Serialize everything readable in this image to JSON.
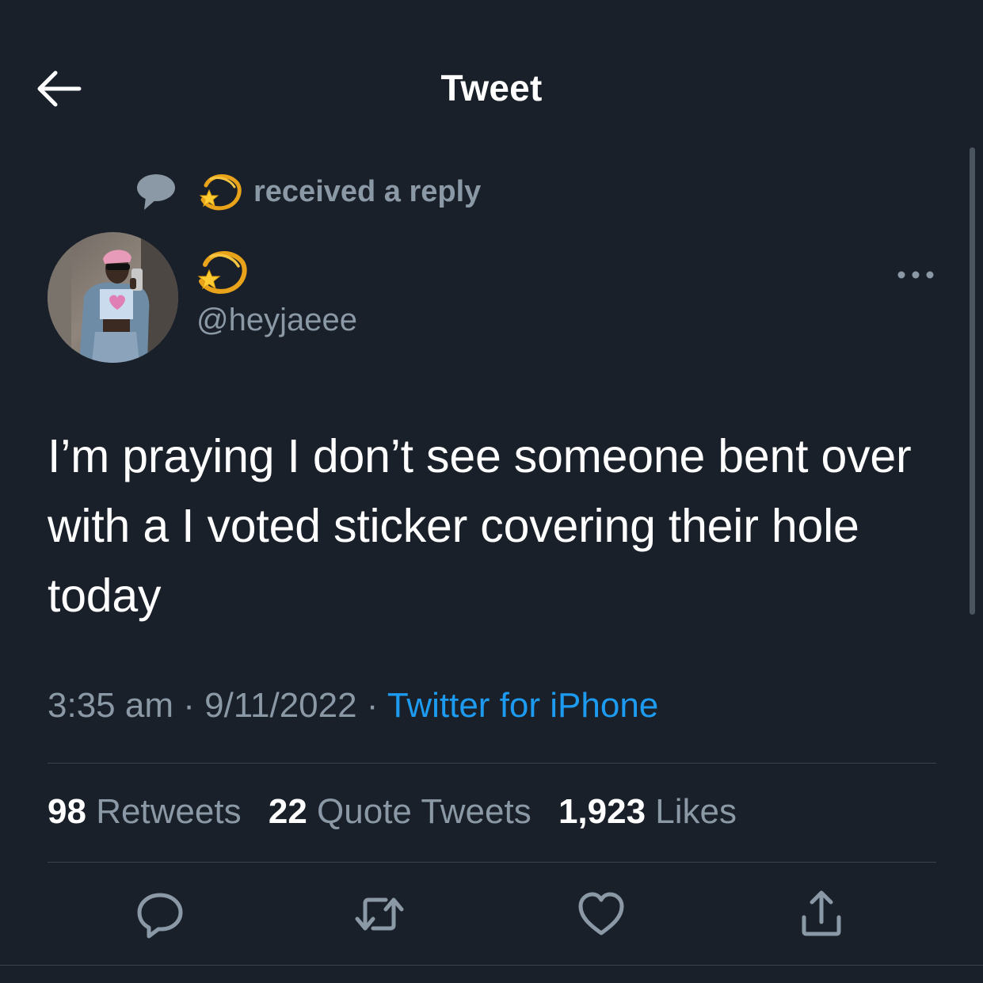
{
  "header": {
    "title": "Tweet"
  },
  "context": {
    "text": "received a reply"
  },
  "author": {
    "handle": "@heyjaeee"
  },
  "tweet": {
    "text": "I’m praying I don’t see someone bent over with a I voted sticker covering their hole today",
    "time": "3:35 am",
    "date": "9/11/2022",
    "separator": " · ",
    "source": "Twitter for iPhone"
  },
  "stats": {
    "retweets_count": "98",
    "retweets_label": "Retweets",
    "quotes_count": "22",
    "quotes_label": "Quote Tweets",
    "likes_count": "1,923",
    "likes_label": "Likes"
  },
  "icons": {
    "back": "arrow-left-icon",
    "context": "speech-bubble-icon",
    "display_name_emoji": "dizzy-emoji",
    "more": "more-horizontal-icon",
    "reply": "reply-icon",
    "retweet": "retweet-icon",
    "like": "heart-icon",
    "share": "share-icon"
  },
  "colors": {
    "background": "#192029",
    "primary_text": "#ffffff",
    "secondary_text": "#8b98a5",
    "link": "#1d9bf0",
    "divider": "#38444d"
  }
}
